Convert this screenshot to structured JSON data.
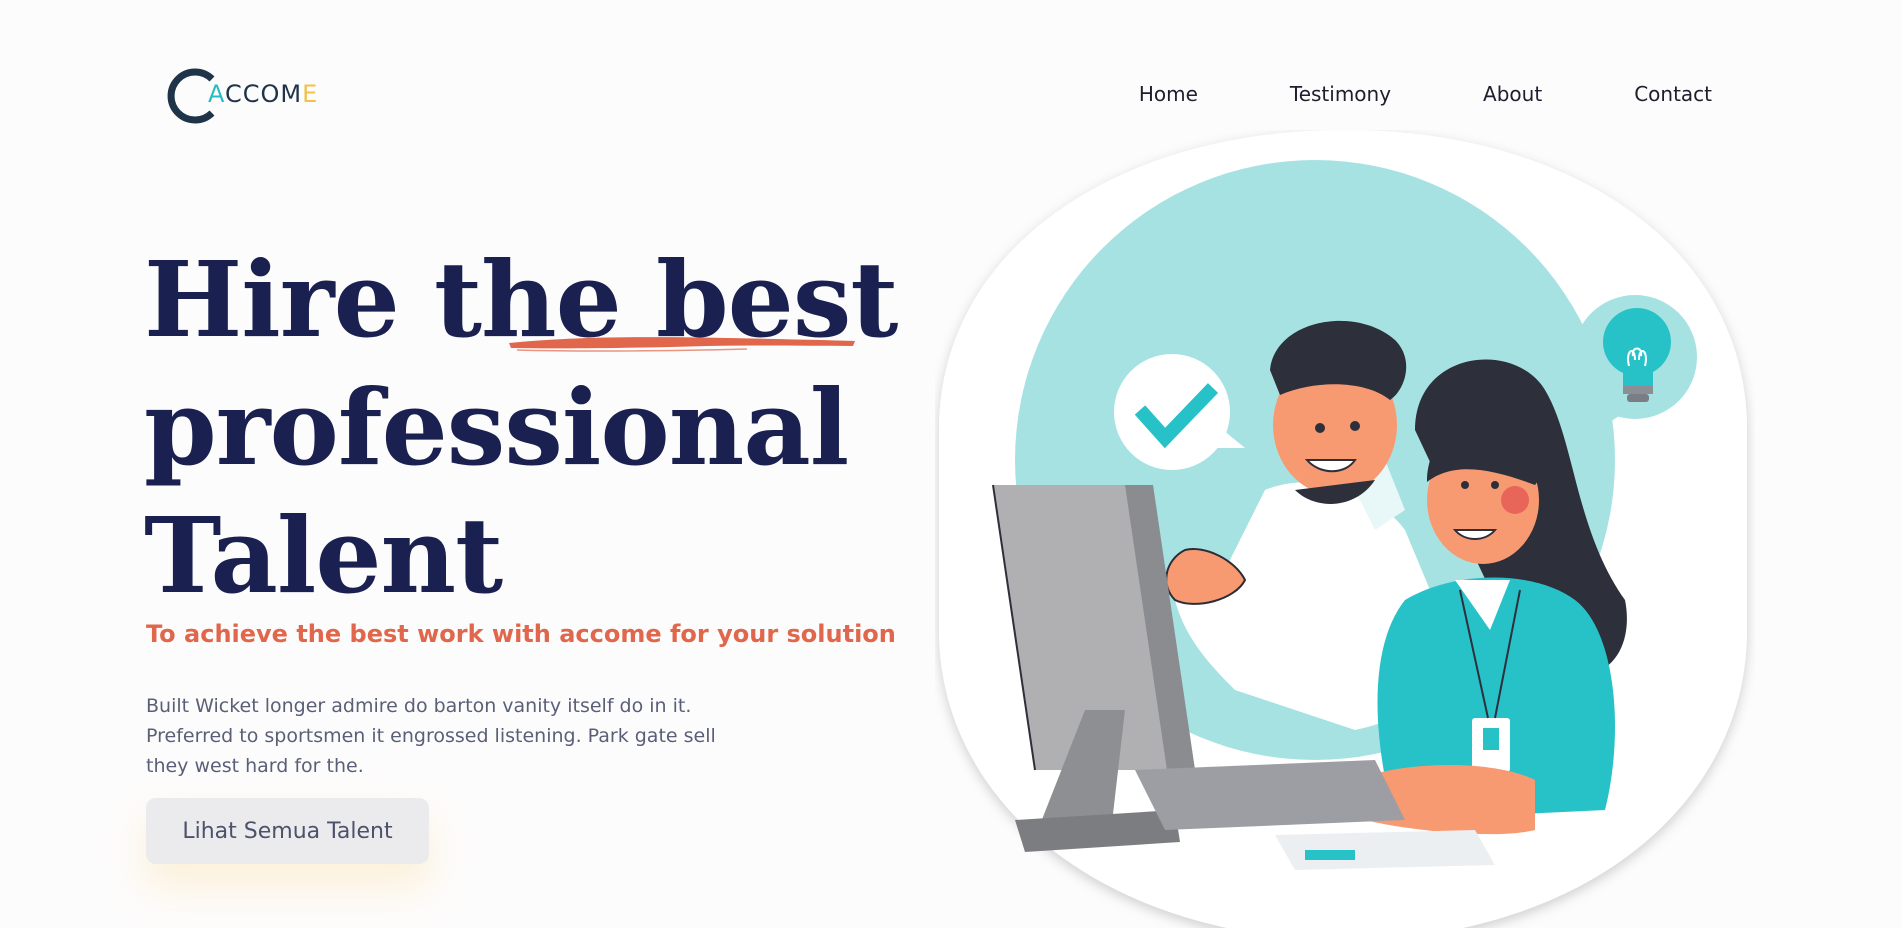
{
  "brand": {
    "logo_prefix": "",
    "logo_a": "A",
    "logo_main": "CCOM",
    "logo_e": "E",
    "colors": {
      "navy": "#1a2150",
      "accent": "#e0674b",
      "teal": "#27bcc4",
      "yellow": "#f4c04a"
    }
  },
  "nav": {
    "items": [
      {
        "label": "Home"
      },
      {
        "label": "Testimony"
      },
      {
        "label": "About"
      },
      {
        "label": "Contact"
      }
    ]
  },
  "hero": {
    "headline_line1": "Hire the best",
    "headline_line2": "professional",
    "headline_line3": "Talent",
    "tagline": "To achieve the best work with accome for your solution",
    "description": "Built Wicket longer admire do barton vanity itself do in it. Preferred to sportsmen it engrossed listening. Park gate sell they west hard for the.",
    "cta_label": "Lihat Semua Talent"
  },
  "illustration": {
    "icons": [
      "checkmark-bubble-icon",
      "lightbulb-bubble-icon"
    ]
  }
}
